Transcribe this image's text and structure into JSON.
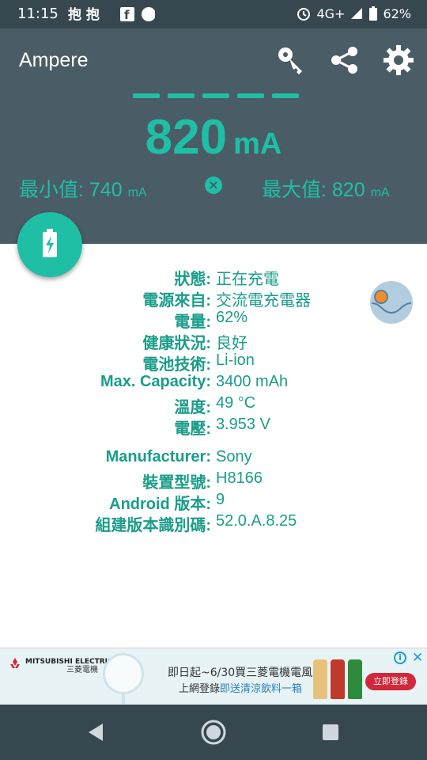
{
  "status_bar": {
    "time": "11:15",
    "network": "4G+",
    "battery": "62%"
  },
  "app": {
    "title": "Ampere"
  },
  "current": {
    "value": "820",
    "unit": "mA"
  },
  "min": {
    "label": "最小值: 740",
    "unit": "mA"
  },
  "max": {
    "label": "最大值: 820",
    "unit": "mA"
  },
  "info": [
    {
      "key": "狀態:",
      "value": "正在充電"
    },
    {
      "key": "電源來自:",
      "value": "交流電充電器"
    },
    {
      "key": "電量:",
      "value": "62%"
    },
    {
      "key": "健康狀況:",
      "value": "良好"
    },
    {
      "key": "電池技術:",
      "value": "Li-ion"
    },
    {
      "key": "Max. Capacity:",
      "value": "3400 mAh"
    },
    {
      "key": "溫度:",
      "value": "49 °C"
    },
    {
      "key": "電壓:",
      "value": "3.953 V"
    },
    {
      "key": "Manufacturer:",
      "value": "Sony"
    },
    {
      "key": "裝置型號:",
      "value": "H8166"
    },
    {
      "key": "Android 版本:",
      "value": "9"
    },
    {
      "key": "組建版本識別碼:",
      "value": "52.0.A.8.25"
    }
  ],
  "ad": {
    "brand_en": "MITSUBISHI ELECTRIC",
    "brand_zh": "三菱電機",
    "line1": "即日起~6/30買三菱電機電風扇",
    "line2_prefix": "上網登錄",
    "line2_highlight": "即送清涼飲料一箱",
    "cta": "立即登錄"
  },
  "colors": {
    "accent": "#1fbfa6",
    "header_bg": "#4a5c66",
    "status_bg": "#37474f",
    "text_value": "#1a9d88"
  },
  "icons": [
    "key-icon",
    "share-icon",
    "gear-icon",
    "battery-charging-icon",
    "close-circle-icon",
    "nav-back-icon",
    "nav-home-icon",
    "nav-recents-icon"
  ]
}
